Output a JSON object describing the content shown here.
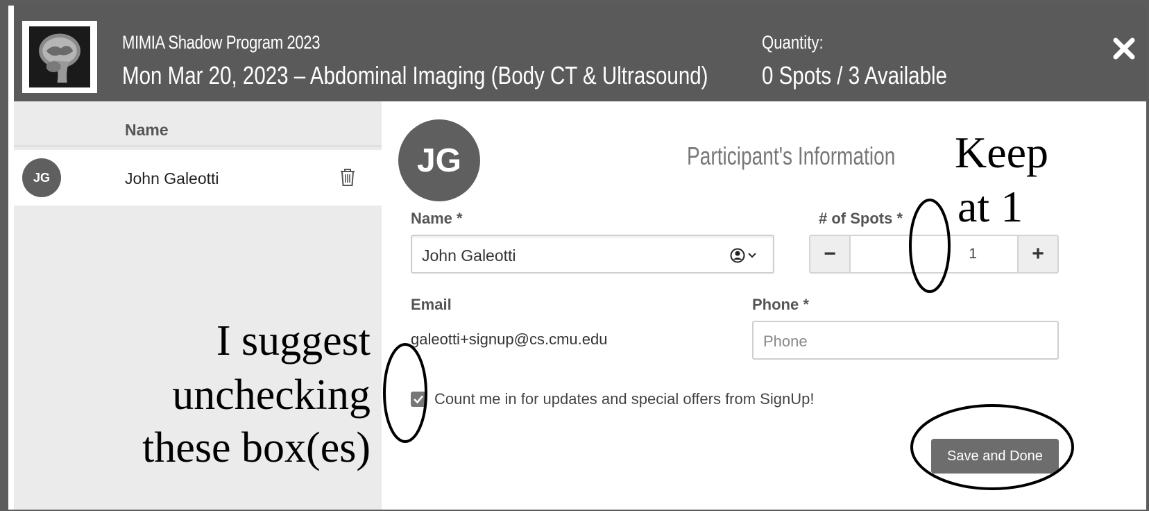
{
  "header": {
    "program_title": "MIMIA Shadow Program 2023",
    "event_title": "Mon Mar 20, 2023 – Abdominal Imaging (Body CT & Ultrasound)",
    "quantity_label": "Quantity:",
    "quantity_value": "0 Spots / 3 Available",
    "close_icon": "close-icon",
    "logo": "brain-mri-logo"
  },
  "participants_list": {
    "column_header": "Name",
    "items": [
      {
        "initials": "JG",
        "name": "John Galeotti",
        "delete_icon": "trash-icon"
      }
    ]
  },
  "form": {
    "avatar_initials": "JG",
    "section_title": "Participant's Information",
    "name_label": "Name *",
    "name_value": "John Galeotti",
    "spots_label": "# of Spots *",
    "spots_value": "1",
    "minus_label": "−",
    "plus_label": "+",
    "email_label": "Email",
    "email_value": "galeotti+signup@cs.cmu.edu",
    "phone_label": "Phone *",
    "phone_placeholder": "Phone",
    "optin_checked": true,
    "optin_text": "Count me in for updates and special offers from SignUp!",
    "save_label": "Save and Done"
  },
  "annotations": {
    "keep_line1": "Keep",
    "keep_line2": "at 1",
    "suggest_line1": "I suggest",
    "suggest_line2": "unchecking",
    "suggest_line3": "these box(es)"
  },
  "colors": {
    "header_bg": "#5a5a5a",
    "left_panel_bg": "#ebebeb",
    "avatar_bg": "#5f5f5f",
    "button_bg": "#6d6d6d"
  }
}
